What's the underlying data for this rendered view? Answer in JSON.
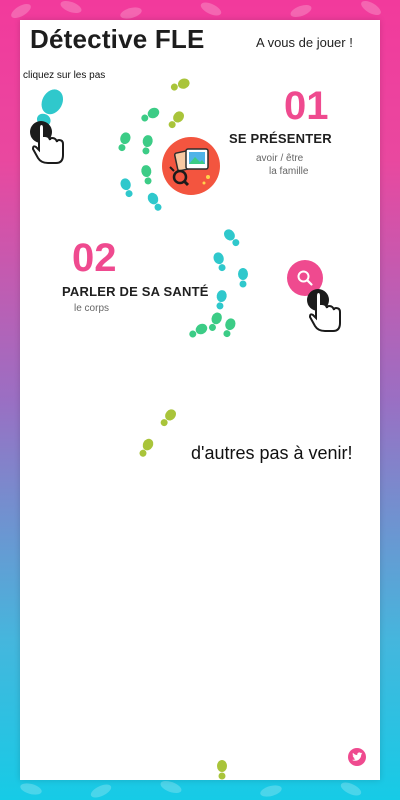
{
  "header": {
    "title": "Détective FLE",
    "subtitle": "A vous de jouer !"
  },
  "hint": "cliquez sur les pas",
  "lessons": [
    {
      "number": "01",
      "title": "SE PRÉSENTER",
      "topics": [
        "avoir / être",
        "la famille"
      ]
    },
    {
      "number": "02",
      "title": "PARLER DE SA SANTÉ",
      "topics": [
        "le corps"
      ]
    }
  ],
  "coming_soon": "d'autres pas à venir!",
  "colors": {
    "accent": "#ef4a8f",
    "footprint_teal": "#2fc8cc",
    "footprint_green": "#3ccc86",
    "footprint_lime": "#a9c43a",
    "photo_bg": "#f3553f"
  },
  "icons": {
    "hand": "pointing-hand-icon",
    "search": "search-icon",
    "photo": "photo-frame-icon",
    "twitter": "twitter-icon"
  }
}
